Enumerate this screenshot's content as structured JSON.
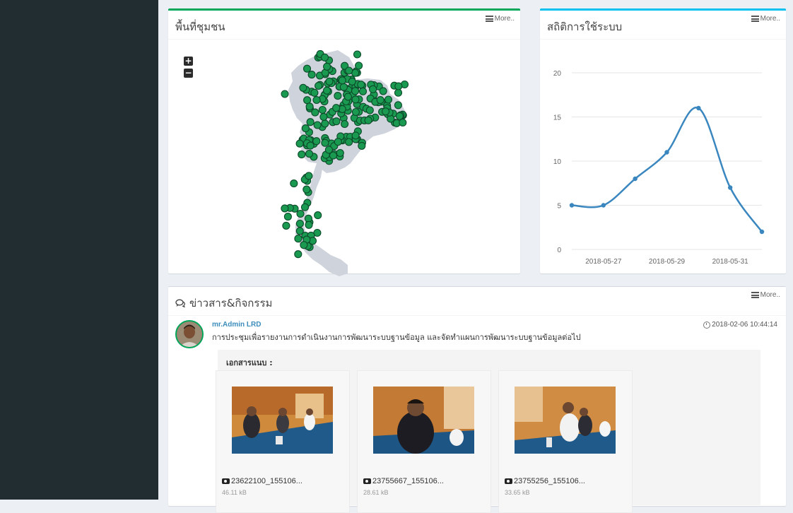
{
  "map_panel": {
    "title": "พื้นที่ชุมชน",
    "more_label": "More..",
    "zoom_in": "+",
    "zoom_out": "−"
  },
  "stats_panel": {
    "title": "สถิติการใช้ระบบ",
    "more_label": "More.."
  },
  "news_panel": {
    "title": "ข่าวสาร&กิจกรรม",
    "more_label": "More..",
    "post": {
      "author": "mr.Admin LRD",
      "datetime": "2018-02-06 10:44:14",
      "text": "การประชุมเพื่อรายงานการดำเนินงานการพัฒนาระบบฐานข้อมูล และจัดทำแผนการพัฒนาระบบฐานข้อมูลต่อไป",
      "attachments_label": "เอกสารแนบ :",
      "attachments": [
        {
          "name": "23622100_155106...",
          "size": "46.11 kB"
        },
        {
          "name": "23755667_155106...",
          "size": "28.61 kB"
        },
        {
          "name": "23755256_155106...",
          "size": "33.65 kB"
        }
      ]
    }
  },
  "colors": {
    "green_accent": "#00a65a",
    "blue_accent": "#00c0ef",
    "line": "#3a87c0",
    "marker": "#1a9a50",
    "sidebar": "#222d32"
  },
  "chart_data": {
    "type": "line",
    "x": [
      "2018-05-26",
      "2018-05-27",
      "2018-05-28",
      "2018-05-29",
      "2018-05-30",
      "2018-05-31",
      "2018-06-01"
    ],
    "values": [
      5,
      5,
      8,
      11,
      16,
      7,
      2
    ],
    "ylim": [
      0,
      20
    ],
    "yticks": [
      0,
      5,
      10,
      15,
      20
    ],
    "xtick_labels": [
      "2018-05-27",
      "2018-05-29",
      "2018-05-31"
    ],
    "xlabel": "",
    "ylabel": "",
    "grid": true,
    "legend": "none"
  }
}
